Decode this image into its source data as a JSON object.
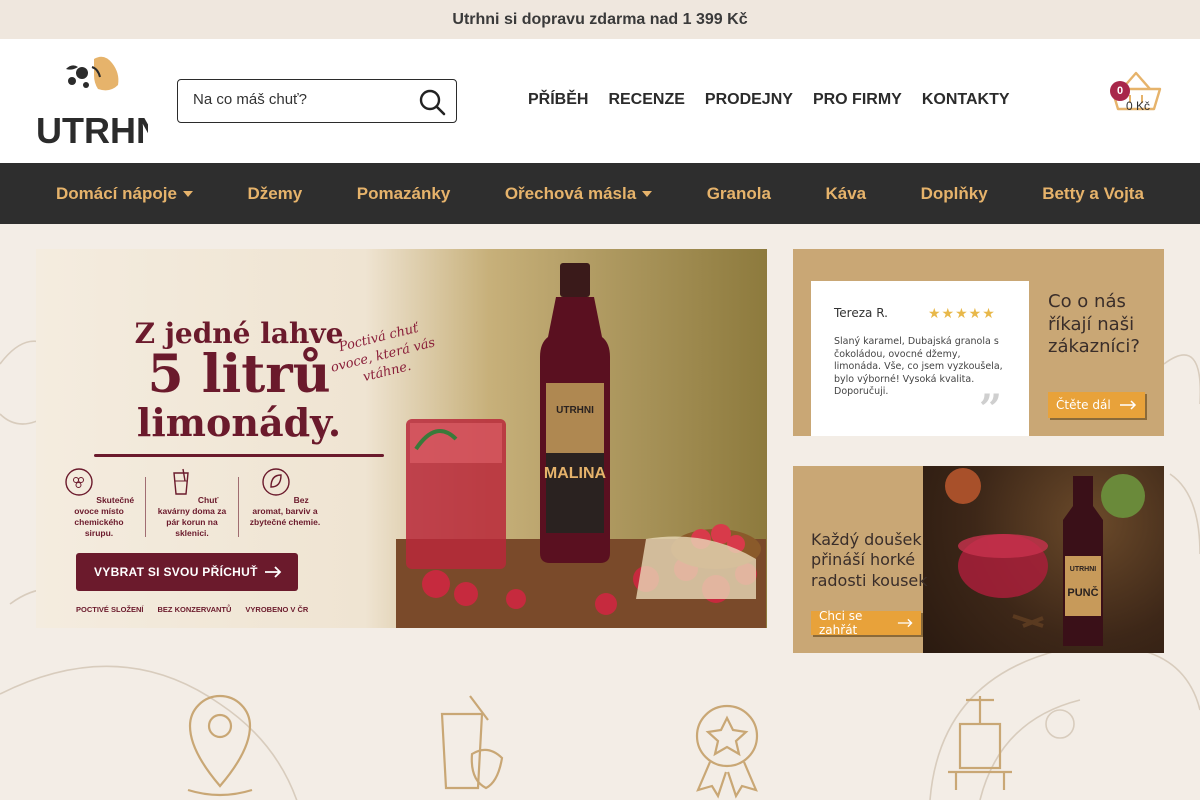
{
  "topbar": {
    "text": "Utrhni si dopravu zdarma nad 1 399 Kč"
  },
  "header": {
    "logo_text": "UTRHNI",
    "search": {
      "placeholder": "Na co máš chuť?"
    },
    "nav": [
      "PŘÍBĚH",
      "RECENZE",
      "PRODEJNY",
      "PRO FIRMY",
      "KONTAKTY"
    ],
    "cart": {
      "count": "0",
      "price": "0 Kč"
    }
  },
  "categories": [
    {
      "label": "Domácí nápoje",
      "dropdown": true
    },
    {
      "label": "Džemy",
      "dropdown": false
    },
    {
      "label": "Pomazánky",
      "dropdown": false
    },
    {
      "label": "Ořechová másla",
      "dropdown": true
    },
    {
      "label": "Granola",
      "dropdown": false
    },
    {
      "label": "Káva",
      "dropdown": false
    },
    {
      "label": "Doplňky",
      "dropdown": false
    },
    {
      "label": "Betty a Vojta",
      "dropdown": false
    }
  ],
  "hero": {
    "line1": "Z jedné lahve",
    "line2": "5 litrů",
    "line3": "limonády.",
    "tagline": "Poctivá chuť ovoce, která vás vtáhne.",
    "features": [
      "Skutečné ovoce místo chemického sirupu.",
      "Chuť kavárny doma za pár korun na sklenici.",
      "Bez aromat, barviv a zbytečné chemie."
    ],
    "cta": "VYBRAT SI SVOU PŘÍCHUŤ",
    "footer": [
      "POCTIVÉ SLOŽENÍ",
      "BEZ KONZERVANTŮ",
      "VYROBENO V ČR"
    ],
    "bottle_brand": "UTRHNI",
    "bottle_label": "MALINA"
  },
  "review": {
    "name": "Tereza R.",
    "stars": "★★★★★",
    "text": "Slaný karamel, Dubajská granola s čokoládou, ovocné džemy, limonáda. Vše, co jsem vyzkoušela, bylo výborné! Vysoká kvalita. Doporučuji.",
    "question": "Co o nás říkají naši zákazníci?",
    "button": "Čtěte dál"
  },
  "punc_banner": {
    "headline": "Každý doušek přináší horké radosti kousek",
    "button": "Chci se zahřát",
    "bottle_brand": "UTRHNI",
    "bottle_label": "PUNČ"
  },
  "colors": {
    "accent": "#e6b36b",
    "wine": "#6b1a2c",
    "badge": "#a8274a",
    "orange_button": "#e8a23a"
  }
}
